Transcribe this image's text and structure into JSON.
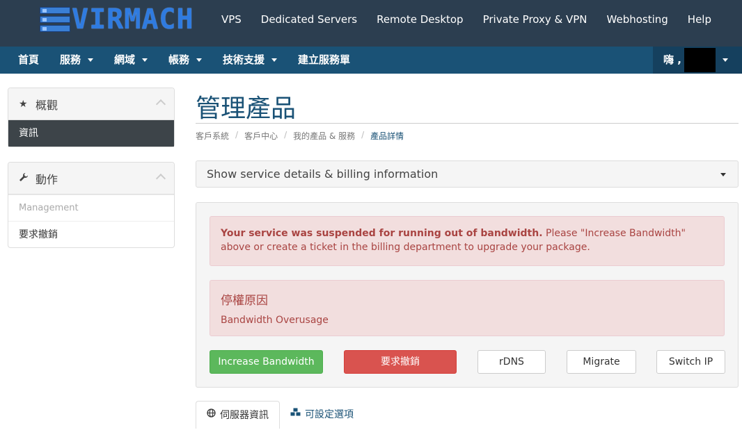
{
  "brand": {
    "logo_text": "VIRMACH"
  },
  "top_nav": [
    "VPS",
    "Dedicated Servers",
    "Remote Desktop",
    "Private Proxy & VPN",
    "Webhosting",
    "Help"
  ],
  "main_nav": {
    "home": "首頁",
    "services": "服務",
    "domains": "網域",
    "billing": "帳務",
    "support": "技術支援",
    "open_ticket": "建立服務單"
  },
  "user_menu": {
    "greeting": "嗨 ,"
  },
  "sidebar": {
    "overview": {
      "title": "概觀",
      "icon": "star-icon",
      "items": [
        "資訊"
      ]
    },
    "actions": {
      "title": "動作",
      "icon": "wrench-icon",
      "items": [
        "Management",
        "要求撤銷"
      ]
    }
  },
  "page": {
    "title": "管理產品",
    "breadcrumb": [
      "客戶系統",
      "客戶中心",
      "我的產品 & 服務",
      "產品詳情"
    ],
    "accordion_label": "Show service details & billing information"
  },
  "alerts": {
    "suspended_bold": "Your service was suspended for running out of bandwidth.",
    "suspended_rest": " Please \"Increase Bandwidth\" above or create a ticket in the billing department to upgrade your package.",
    "reason_title": "停權原因",
    "reason_text": "Bandwidth Overusage"
  },
  "buttons": {
    "increase_bandwidth": "Increase Bandwidth",
    "request_cancel": "要求撤銷",
    "rdns": "rDNS",
    "migrate": "Migrate",
    "switch_ip": "Switch IP"
  },
  "tabs": {
    "server_info": "伺服器資訊",
    "configurable_options": "可設定選項"
  },
  "colors": {
    "topbar": "#2c3e50",
    "mainnav": "#1a5276",
    "green": "#5cb85c",
    "red": "#d9534f"
  }
}
